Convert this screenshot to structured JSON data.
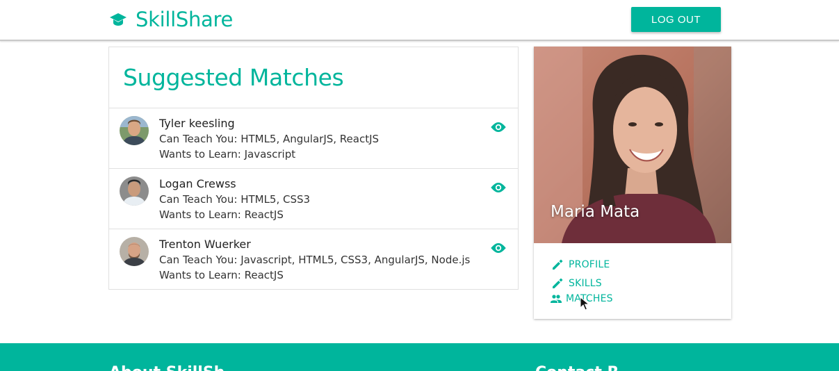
{
  "header": {
    "brand_name": "SkillShare",
    "brand_icon": "graduation-cap-icon",
    "logout_label": "LOG OUT"
  },
  "matches": {
    "title": "Suggested Matches",
    "teach_prefix": "Can Teach You: ",
    "learn_prefix": "Wants to Learn: ",
    "items": [
      {
        "name": "Tyler keesling",
        "can_teach": "HTML5, AngularJS, ReactJS",
        "wants_to_learn": "Javascript"
      },
      {
        "name": "Logan Crewss",
        "can_teach": "HTML5, CSS3",
        "wants_to_learn": "ReactJS"
      },
      {
        "name": "Trenton Wuerker",
        "can_teach": "Javascript, HTML5, CSS3, AngularJS, Node.js",
        "wants_to_learn": "ReactJS"
      }
    ],
    "view_icon": "eye-icon"
  },
  "profile": {
    "name": "Maria Mata",
    "links": {
      "profile": "PROFILE",
      "skills": "SKILLS",
      "matches": "MATCHES"
    }
  },
  "footer": {
    "about_heading": "About SkillSh",
    "contact_heading": "Contact R"
  },
  "colors": {
    "accent": "#00b59c",
    "border": "#e0e0e0"
  }
}
